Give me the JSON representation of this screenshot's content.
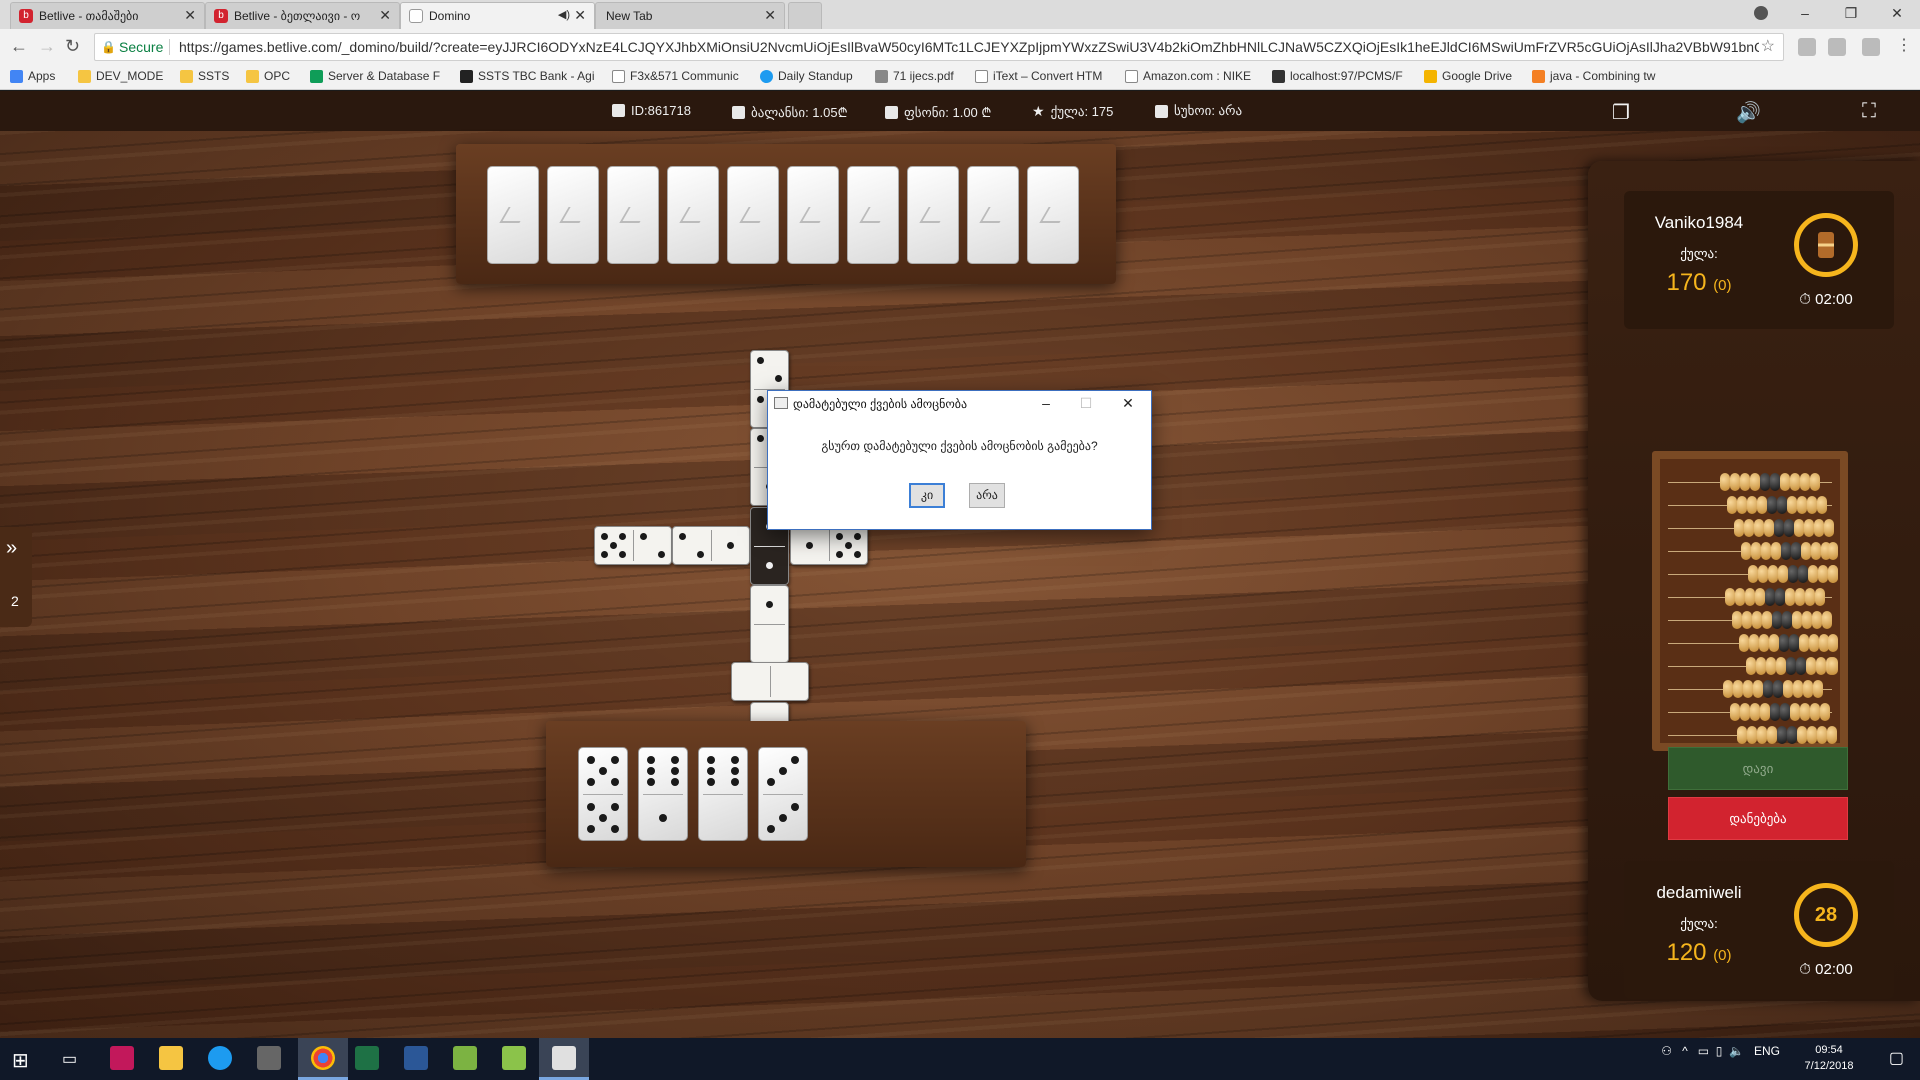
{
  "browser": {
    "tabs": [
      {
        "label": "Betlive - თამაშები",
        "active": false
      },
      {
        "label": "Betlive - ბეთლაივი - ო",
        "active": false
      },
      {
        "label": "Domino",
        "active": true
      },
      {
        "label": "New Tab",
        "active": false
      }
    ],
    "security_label": "Secure",
    "url": "https://games.betlive.com/_domino/build/?create=eyJJRCI6ODYxNzE4LCJQYXJhbXMiOnsiU2NvcmUiOjEsIlBvaW50cyI6MTc1LCJEYXZpIjpmYWxzZSwiU3V4b2kiOmZhbHNlLCJNaW5CZXQiOjEsIk1heEJldCI6MSwiUmFrZVR5cGUiOjAsIlJha2VBbW91bnQiOjAuMD..."
  },
  "bookmarks": [
    "Apps",
    "DEV_MODE",
    "SSTS",
    "OPC",
    "Server & Database F",
    "SSTS TBC Bank - Agi",
    "F3x&571 Communic",
    "Daily Standup",
    "71 ijecs.pdf",
    "iText – Convert HTM",
    "Amazon.com : NIKE",
    "localhost:97/PCMS/F",
    "Google Drive",
    "java - Combining tw"
  ],
  "infobar": {
    "id": "ID:861718",
    "balance": "ბალანსი: 1.05₾",
    "bet": "ფსონი: 1.00 ₾",
    "points": "ქულა: 175",
    "suxoi": "სუხოი: არა"
  },
  "side_tab_count": "2",
  "players": [
    {
      "name": "Vaniko1984",
      "label": "ქულა:",
      "score": "170",
      "extra": "(0)",
      "time": "02:00",
      "ring": ""
    },
    {
      "name": "dedamiweli",
      "label": "ქულა:",
      "score": "120",
      "extra": "(0)",
      "time": "02:00",
      "ring": "28"
    }
  ],
  "buttons": {
    "play": "დავი",
    "give_up": "დანებება"
  },
  "dialog": {
    "title": "დამატებული ქვების ამოცნობა",
    "message": "გსურთ დამატებული ქვების ამოცნობის გამეება?",
    "yes": "კი",
    "no": "არა"
  },
  "taskbar": {
    "lang": "ENG",
    "time": "09:54",
    "date": "7/12/2018"
  }
}
